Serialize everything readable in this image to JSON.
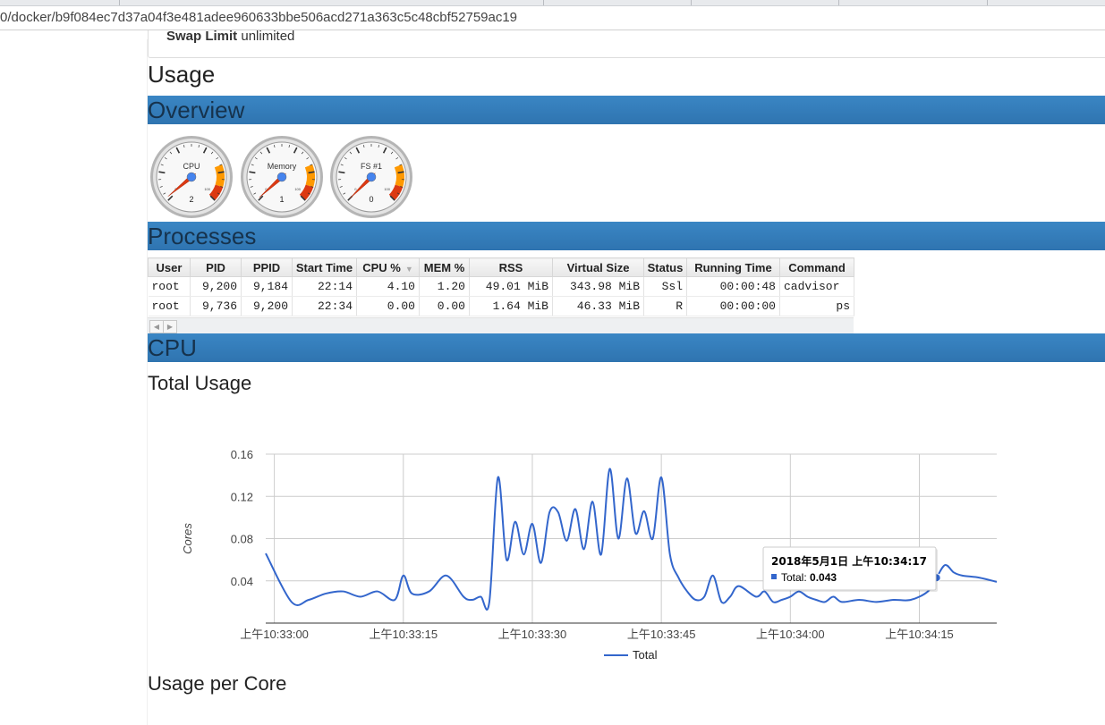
{
  "browser": {
    "url": "0/docker/b9f084ec7d37a04f3e481adee960633bbe506acd271a363c5c48cbf52759ac19"
  },
  "limits": {
    "swap_label": "Swap Limit",
    "swap_value": "unlimited"
  },
  "usage": {
    "title": "Usage",
    "overview": {
      "title": "Overview",
      "gauges": [
        {
          "label": "CPU",
          "value": 2,
          "value_text": "2"
        },
        {
          "label": "Memory",
          "value": 1,
          "value_text": "1"
        },
        {
          "label": "FS #1",
          "value": 0,
          "value_text": "0"
        }
      ],
      "gauge_scale_labels": [
        "0",
        "100"
      ]
    },
    "processes": {
      "title": "Processes",
      "columns": [
        "User",
        "PID",
        "PPID",
        "Start Time",
        "CPU %",
        "MEM %",
        "RSS",
        "Virtual Size",
        "Status",
        "Running Time",
        "Command"
      ],
      "sort_indicator": "▼",
      "rows": [
        [
          "root",
          "9,200",
          "9,184",
          "22:14",
          "4.10",
          "1.20",
          "49.01 MiB",
          "343.98 MiB",
          "Ssl",
          "00:00:48",
          "cadvisor"
        ],
        [
          "root",
          "9,736",
          "9,200",
          "22:34",
          "0.00",
          "0.00",
          "1.64 MiB",
          "46.33 MiB",
          "R",
          "00:00:00",
          "ps"
        ]
      ]
    }
  },
  "cpu": {
    "title": "CPU",
    "total_usage_title": "Total Usage",
    "per_core_title": "Usage per Core"
  },
  "tooltip": {
    "title": "2018年5月1日 上午10:34:17",
    "series": "Total",
    "value": "0.043"
  },
  "colors": {
    "section_bar": "#337ab7",
    "series": "#3366cc",
    "gauge_red": "#dc3912",
    "gauge_orange": "#ff9900"
  },
  "chart_data": {
    "type": "line",
    "title": "",
    "xlabel": "",
    "ylabel": "Cores",
    "ylim": [
      0.0,
      0.16
    ],
    "yticks": [
      "0.16",
      "0.12",
      "0.08",
      "0.04"
    ],
    "xticks": [
      "上午10:33:00",
      "上午10:33:15",
      "上午10:33:30",
      "上午10:33:45",
      "上午10:34:00",
      "上午10:34:15"
    ],
    "x_start": "10:32:59",
    "x_end": "10:34:24",
    "legend": "bottom",
    "grid": true,
    "series": [
      {
        "name": "Total",
        "x": [
          "10:32:59",
          "10:33:02",
          "10:33:04",
          "10:33:06",
          "10:33:08",
          "10:33:10",
          "10:33:12",
          "10:33:14",
          "10:33:15",
          "10:33:16",
          "10:33:18",
          "10:33:20",
          "10:33:22",
          "10:33:23",
          "10:33:24",
          "10:33:25",
          "10:33:26",
          "10:33:27",
          "10:33:28",
          "10:33:29",
          "10:33:30",
          "10:33:31",
          "10:33:32",
          "10:33:33",
          "10:33:34",
          "10:33:35",
          "10:33:36",
          "10:33:37",
          "10:33:38",
          "10:33:39",
          "10:33:40",
          "10:33:41",
          "10:33:42",
          "10:33:43",
          "10:33:44",
          "10:33:45",
          "10:33:46",
          "10:33:47",
          "10:33:48",
          "10:33:49",
          "10:33:50",
          "10:33:51",
          "10:33:52",
          "10:33:53",
          "10:33:54",
          "10:33:56",
          "10:33:57",
          "10:33:58",
          "10:33:59",
          "10:34:00",
          "10:34:01",
          "10:34:02",
          "10:34:03",
          "10:34:04",
          "10:34:05",
          "10:34:06",
          "10:34:08",
          "10:34:10",
          "10:34:12",
          "10:34:14",
          "10:34:16",
          "10:34:17",
          "10:34:18",
          "10:34:19",
          "10:34:20",
          "10:34:22",
          "10:34:24"
        ],
        "values": [
          0.066,
          0.02,
          0.022,
          0.028,
          0.03,
          0.025,
          0.03,
          0.022,
          0.045,
          0.028,
          0.03,
          0.045,
          0.025,
          0.022,
          0.025,
          0.02,
          0.138,
          0.06,
          0.096,
          0.065,
          0.094,
          0.057,
          0.105,
          0.105,
          0.078,
          0.108,
          0.07,
          0.115,
          0.065,
          0.146,
          0.08,
          0.137,
          0.085,
          0.106,
          0.08,
          0.138,
          0.065,
          0.043,
          0.03,
          0.022,
          0.025,
          0.045,
          0.02,
          0.025,
          0.035,
          0.025,
          0.03,
          0.02,
          0.022,
          0.025,
          0.03,
          0.025,
          0.022,
          0.02,
          0.025,
          0.02,
          0.022,
          0.02,
          0.022,
          0.022,
          0.03,
          0.043,
          0.055,
          0.048,
          0.045,
          0.043,
          0.039
        ]
      }
    ]
  }
}
